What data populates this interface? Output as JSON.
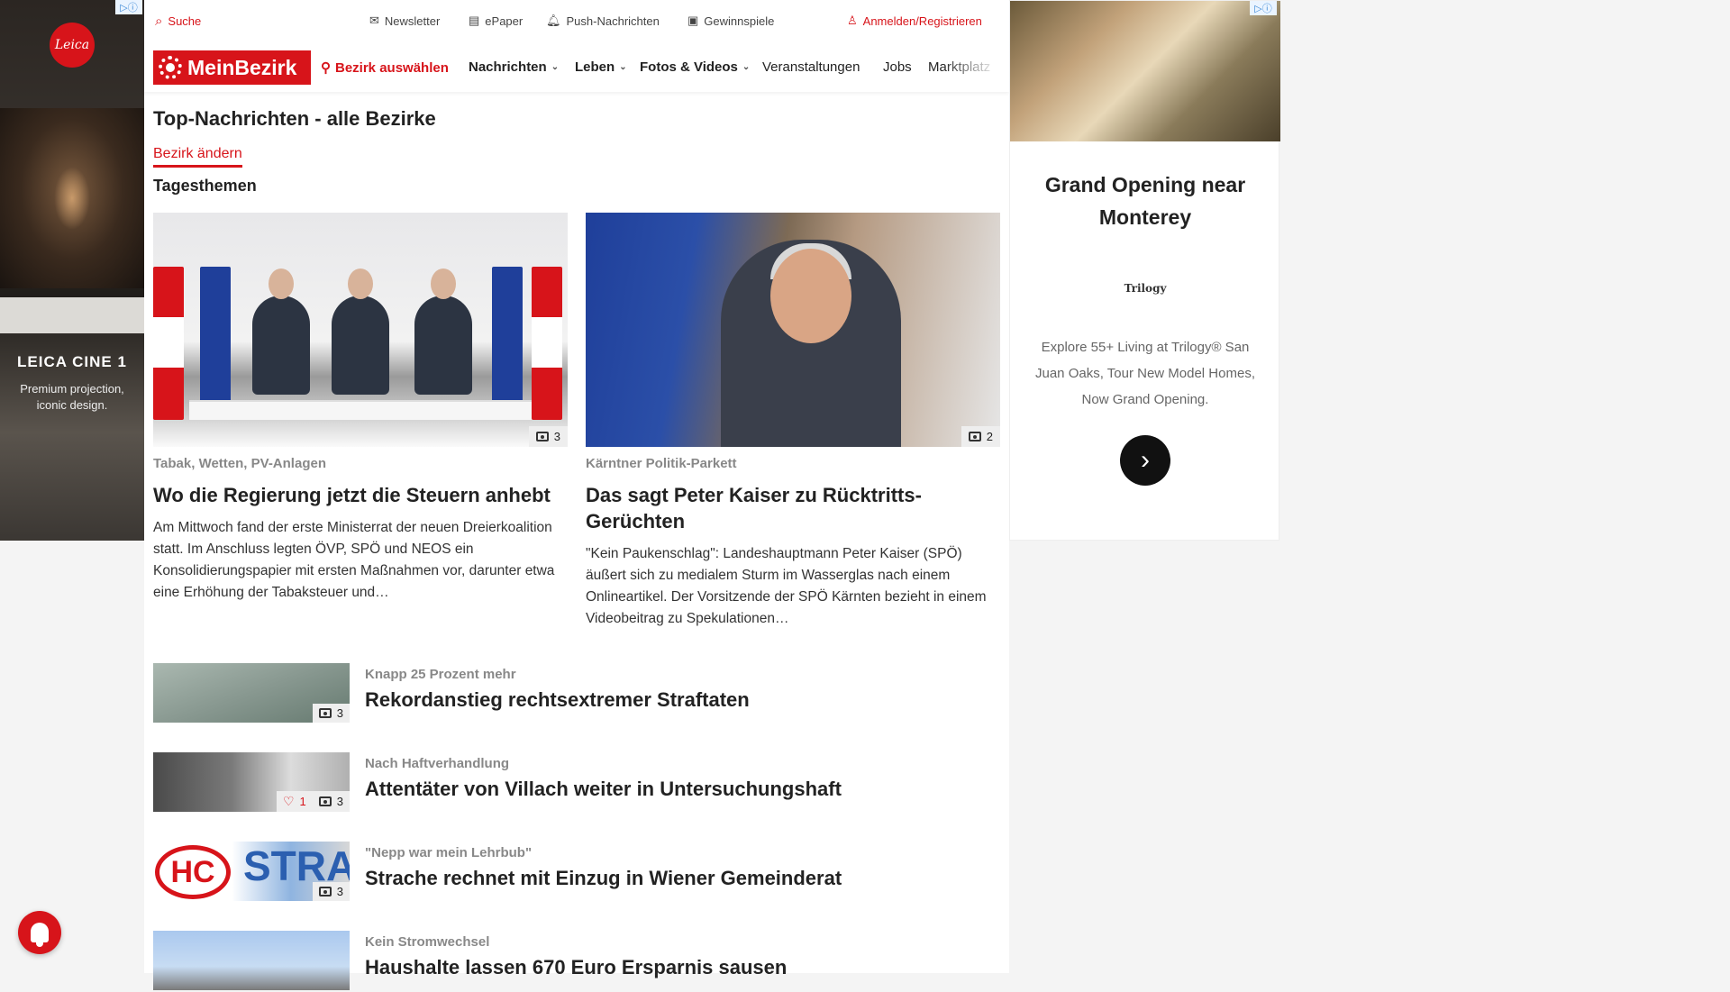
{
  "left_ad": {
    "logo": "Leica",
    "title": "LEICA CINE 1",
    "subtitle": "Premium projection, iconic design."
  },
  "topbar": {
    "search": "Suche",
    "newsletter": "Newsletter",
    "epaper": "ePaper",
    "push": "Push-Nachrichten",
    "games": "Gewinnspiele",
    "login": "Anmelden/Registrieren"
  },
  "brand": "MeinBezirk",
  "nav": {
    "district": "Bezirk auswählen",
    "items": [
      "Nachrichten",
      "Leben",
      "Fotos & Videos",
      "Veranstaltungen",
      "Jobs",
      "Marktplatz"
    ]
  },
  "page": {
    "title": "Top-Nachrichten - alle Bezirke",
    "change_district": "Bezirk ändern",
    "section": "Tagesthemen"
  },
  "featured": [
    {
      "kicker": "Tabak, Wetten, PV-Anlagen",
      "title": "Wo die Regierung jetzt die Steuern anhebt",
      "teaser": "Am Mittwoch fand der erste Ministerrat der neuen Dreierkoalition statt. Im Anschluss legten ÖVP, SPÖ und NEOS ein Konsolidierungspapier mit ersten Maßnahmen vor, darunter etwa eine Erhöhung der Tabaksteuer und…",
      "photos": "3"
    },
    {
      "kicker": "Kärntner Politik-Parkett",
      "title": "Das sagt Peter Kaiser zu Rücktritts-Gerüchten",
      "teaser": "\"Kein Paukenschlag\": Landeshauptmann Peter Kaiser (SPÖ) äußert sich zu medialem Sturm im Wasserglas nach einem Onlineartikel. Der Vorsitzende der SPÖ Kärnten bezieht in einem Videobeitrag zu Spekulationen…",
      "photos": "2"
    }
  ],
  "list": [
    {
      "kicker": "Knapp 25 Prozent mehr",
      "title": "Rekordanstieg rechtsextremer Straftaten",
      "photos": "3"
    },
    {
      "kicker": "Nach Haftverhandlung",
      "title": "Attentäter von Villach weiter in Untersuchungshaft",
      "photos": "3",
      "likes": "1"
    },
    {
      "kicker": "\"Nepp war mein Lehrbub\"",
      "title": "Strache rechnet mit Einzug in Wiener Gemeinderat",
      "photos": "3",
      "thumb_text_1": "HC",
      "thumb_text_2": "STRAC"
    },
    {
      "kicker": "Kein Stromwechsel",
      "title": "Haushalte lassen 670 Euro Ersparnis sausen"
    }
  ],
  "right_ad": {
    "headline": "Grand Opening near Monterey",
    "brand": "Trilogy",
    "description": "Explore 55+ Living at Trilogy® San Juan Oaks, Tour New Model Homes, Now Grand Opening.",
    "cta_icon": "chevron-right-icon"
  },
  "colors": {
    "brand_red": "#d7141a",
    "text": "#222222",
    "muted": "#888888"
  }
}
